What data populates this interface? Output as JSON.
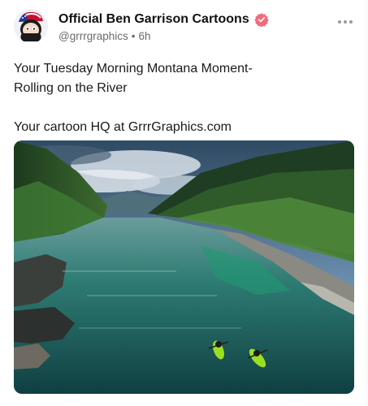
{
  "author": {
    "display_name": "Official  Ben Garrison Cartoons",
    "handle": "@grrrgraphics",
    "separator": "•",
    "time_ago": "6h",
    "avatar_icon": "cartoon-character-avatar",
    "verified_icon": "verified-badge-icon",
    "verified_color": "#f26b7a"
  },
  "post": {
    "lines": [
      "Your Tuesday Morning Montana Moment-",
      "Rolling on the River",
      "",
      "Your cartoon HQ at GrrrGraphics.com"
    ],
    "media_icon": "river-kayaks-photo"
  },
  "actions": {
    "more_icon": "more-options-icon"
  }
}
